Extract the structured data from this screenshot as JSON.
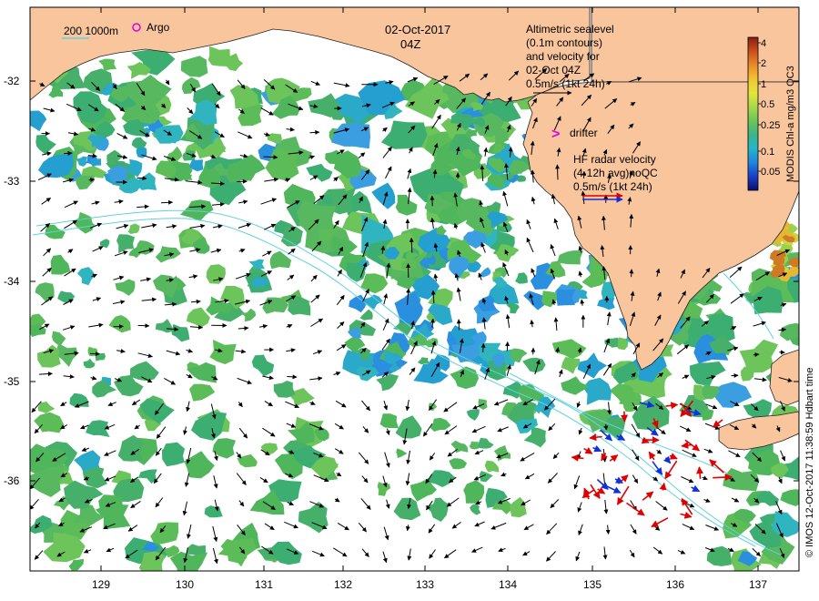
{
  "map": {
    "date": "02-Oct-2017",
    "time": "04Z",
    "lon_ticks": [
      "129",
      "130",
      "131",
      "132",
      "133",
      "134",
      "135",
      "136",
      "137"
    ],
    "lat_ticks": [
      "-32",
      "-33",
      "-34",
      "-35",
      "-36"
    ]
  },
  "legend": {
    "isobath": "200  1000m",
    "argo": "Argo",
    "altimetry_lines": [
      "Altimetric sealevel",
      "(0.1m contours)",
      "and velocity for",
      "02-Oct 04Z",
      "0.5m/s (1kt 24h)"
    ],
    "drifter_symbol": ">",
    "drifter": "drifter",
    "hf_lines": [
      "HF radar velocity",
      "(4-12h avg)noQC",
      "0.5m/s (1kt 24h)"
    ]
  },
  "colorbar": {
    "title": "MODIS Chl-a mg/m3 OC3",
    "labels": [
      "4",
      "2",
      "1",
      "0.5",
      "0.25",
      "0.1",
      "0.05"
    ],
    "colors": [
      "#08106e",
      "#1a3fc8",
      "#1e86e0",
      "#25b6c8",
      "#3ab58a",
      "#6cc65a",
      "#a8d84a",
      "#e3e63a",
      "#f1c532",
      "#e88a2a",
      "#c8501c",
      "#8a1e10"
    ]
  },
  "credit": "© IMOS 12-Oct-2017 11:38:59 Hdbart time",
  "colors": {
    "land": "#f8c59c",
    "ocean": "#ffffff",
    "chl_mid": "#56b85e",
    "chl_low": "#2aa9c9",
    "hf_red": "#e00000",
    "hf_blue": "#1030e0",
    "argo": "#e000e0",
    "isobath": "#5fd3df"
  }
}
